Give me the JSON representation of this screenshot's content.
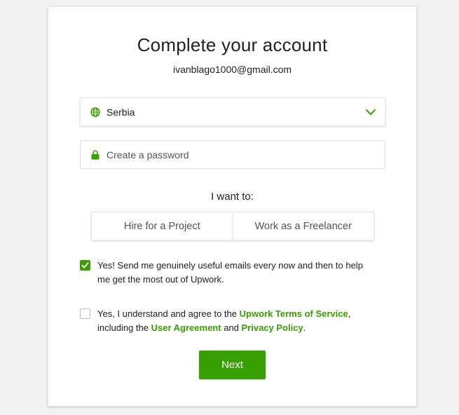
{
  "form": {
    "title": "Complete your account",
    "email": "ivanblago1000@gmail.com",
    "country": {
      "value": "Serbia",
      "icon": "globe-icon"
    },
    "password": {
      "placeholder": "Create a password",
      "icon": "lock-icon"
    },
    "want_label": "I want to:",
    "options": [
      {
        "label": "Hire for a Project"
      },
      {
        "label": "Work as a Freelancer"
      }
    ],
    "emails_opt_in": {
      "checked": true,
      "text": "Yes! Send me genuinely useful emails every now and then to help me get the most out of Upwork."
    },
    "terms": {
      "checked": false,
      "prefix": "Yes, I understand and agree to the ",
      "tos_link": "Upwork Terms of Service",
      "middle1": ", including the ",
      "ua_link": "User Agreement",
      "middle2": " and ",
      "pp_link": "Privacy Policy",
      "suffix": "."
    },
    "next_label": "Next"
  },
  "colors": {
    "accent": "#37a000",
    "text": "#222222",
    "muted": "#555555",
    "border": "#e0e0e0"
  }
}
